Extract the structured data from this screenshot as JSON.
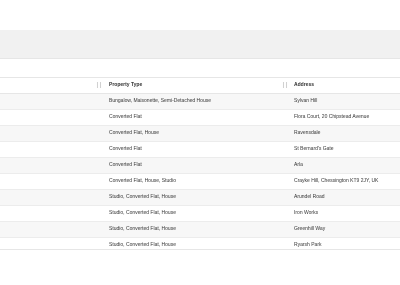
{
  "table": {
    "columns": [
      {
        "key": "property_type",
        "label": "Property Type"
      },
      {
        "key": "address",
        "label": "Address"
      }
    ],
    "rows": [
      {
        "property_type": "Bungalow, Maisonette, Semi-Detached House",
        "address": "Sylvan Hill"
      },
      {
        "property_type": "Converted Flat",
        "address": "Flora Court, 20 Chipstead Avenue"
      },
      {
        "property_type": "Converted Flat, House",
        "address": "Ravensdale"
      },
      {
        "property_type": "Converted Flat",
        "address": "St Bernard's Gate"
      },
      {
        "property_type": "Converted Flat",
        "address": "Arla"
      },
      {
        "property_type": "Converted Flat, House, Studio",
        "address": "Crayke Hill, Chessington KT9 2JY, UK"
      },
      {
        "property_type": "Studio, Converted Flat, House",
        "address": "Arundel Road"
      },
      {
        "property_type": "Studio, Converted Flat, House",
        "address": "Iron Works"
      },
      {
        "property_type": "Studio, Converted Flat, House",
        "address": "Greenhill Way"
      },
      {
        "property_type": "Studio, Converted Flat, House",
        "address": "Ryarsh Park"
      }
    ]
  },
  "icons": {
    "column_resize": "drag-handle-icon"
  }
}
